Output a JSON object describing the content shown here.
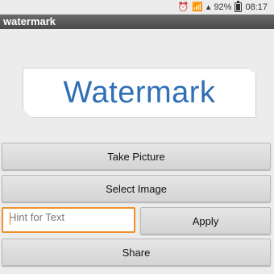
{
  "status_bar": {
    "battery": "92%",
    "time": "08:17",
    "icons": [
      "alarm-icon",
      "wifi-icon",
      "signal-icon",
      "battery-icon"
    ]
  },
  "app": {
    "title": "watermark"
  },
  "preview": {
    "watermark_text": "Watermark"
  },
  "buttons": {
    "take_picture": "Take Picture",
    "select_image": "Select Image",
    "apply": "Apply",
    "share": "Share"
  },
  "hint_input": {
    "placeholder": "Hint for Text",
    "value": ""
  },
  "colors": {
    "accent": "#f0902e",
    "watermark_text": "#2f6fb6",
    "title_bar": "#555555"
  }
}
